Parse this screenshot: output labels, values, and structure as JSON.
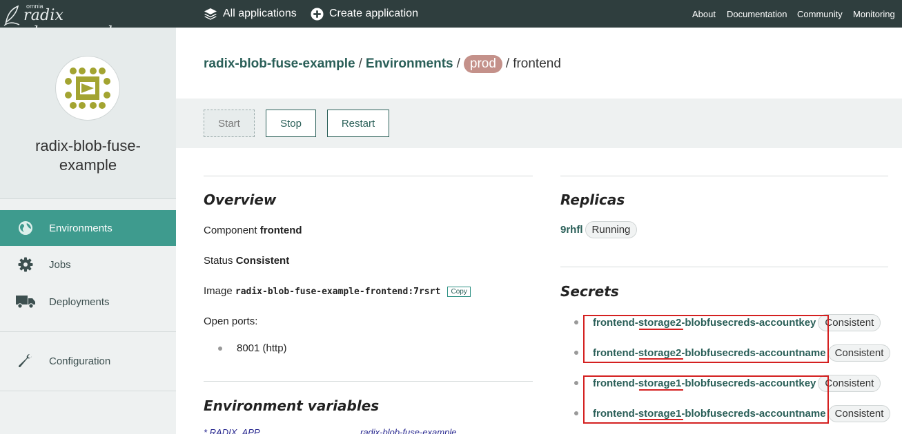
{
  "topbar": {
    "logo_omnia": "omnia",
    "logo_brand": "radix playground",
    "all_applications": "All applications",
    "create_application": "Create application",
    "about": "About",
    "documentation": "Documentation",
    "community": "Community",
    "monitoring": "Monitoring"
  },
  "sidebar": {
    "app_name": "radix-blob-fuse-example",
    "items": [
      {
        "label": "Environments",
        "icon": "globe-icon",
        "active": true
      },
      {
        "label": "Jobs",
        "icon": "gear-icon",
        "active": false
      },
      {
        "label": "Deployments",
        "icon": "truck-icon",
        "active": false
      },
      {
        "label": "Configuration",
        "icon": "wrench-icon",
        "active": false
      }
    ]
  },
  "breadcrumb": {
    "app": "radix-blob-fuse-example",
    "environments": "Environments",
    "env": "prod",
    "component": "frontend",
    "separator": "/"
  },
  "actions": {
    "start": "Start",
    "stop": "Stop",
    "restart": "Restart"
  },
  "overview": {
    "heading": "Overview",
    "component_label": "Component",
    "component_value": "frontend",
    "status_label": "Status",
    "status_value": "Consistent",
    "image_label": "Image",
    "image_value": "radix-blob-fuse-example-frontend:7rsrt",
    "copy_label": "Copy",
    "ports_label": "Open ports:",
    "ports": [
      "8001 (http)"
    ]
  },
  "env_vars": {
    "heading": "Environment variables",
    "first_name": "* RADIX_APP",
    "first_value": "radix-blob-fuse-example"
  },
  "replicas": {
    "heading": "Replicas",
    "name": "9rhfl",
    "status": "Running"
  },
  "secrets": {
    "heading": "Secrets",
    "items": [
      {
        "name": "frontend-storage2-blobfusecreds-accountkey",
        "status": "Consistent"
      },
      {
        "name": "frontend-storage2-blobfusecreds-accountname",
        "status": "Consistent"
      },
      {
        "name": "frontend-storage1-blobfusecreds-accountkey",
        "status": "Consistent"
      },
      {
        "name": "frontend-storage1-blobfusecreds-accountname",
        "status": "Consistent"
      }
    ]
  },
  "colors": {
    "topbar": "#2f3e3e",
    "accent": "#3e9b8e",
    "link": "#2a5f58",
    "env_pill": "#c4918a",
    "highlight": "#d42020"
  }
}
